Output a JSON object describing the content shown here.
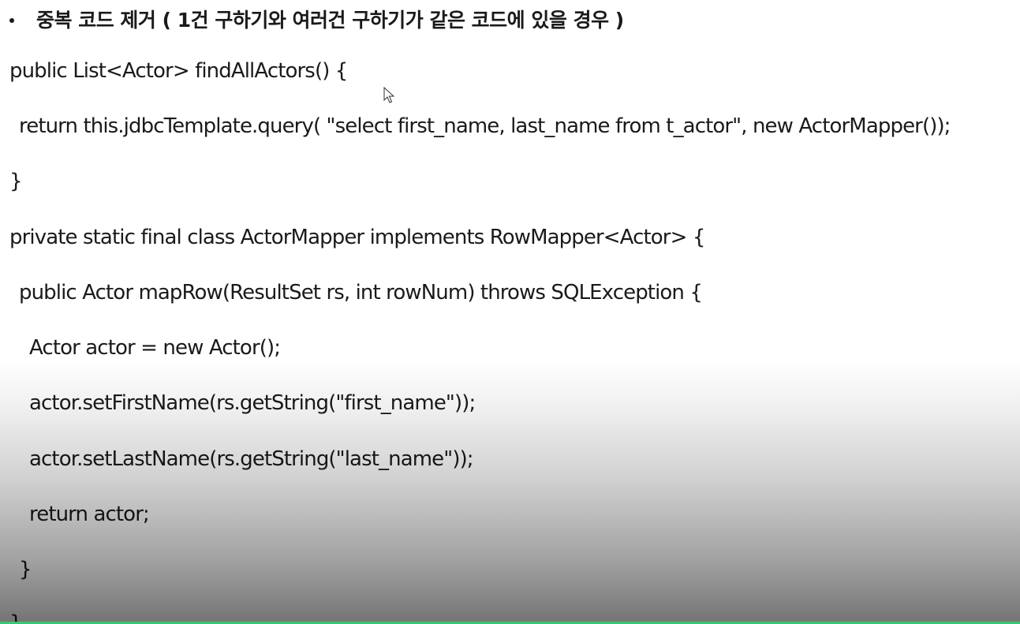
{
  "slide": {
    "heading": "중복 코드 제거 ( 1건 구하기와 여러건 구하기가 같은 코드에 있을 경우 )",
    "code_lines": [
      "public List<Actor> findAllActors() {",
      "return this.jdbcTemplate.query( \"select first_name, last_name from t_actor\", new ActorMapper());",
      "}",
      "private static final class ActorMapper implements RowMapper<Actor> {",
      "public Actor mapRow(ResultSet rs, int rowNum) throws SQLException {",
      "Actor actor = new Actor();",
      "actor.setFirstName(rs.getString(\"first_name\"));",
      "actor.setLastName(rs.getString(\"last_name\"));",
      "return actor;",
      "}",
      "}"
    ]
  },
  "colors": {
    "text": "#1a1a1a",
    "accent_bar": "#2ecc71"
  }
}
